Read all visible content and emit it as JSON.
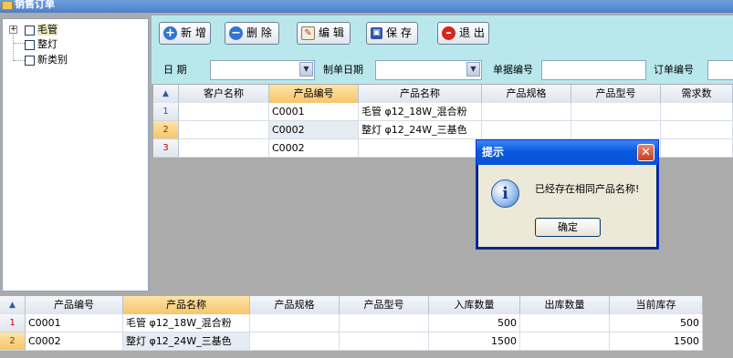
{
  "window": {
    "title": "销售订单"
  },
  "tree": {
    "nodes": [
      {
        "label": "毛管",
        "expandable": true
      },
      {
        "label": "整灯"
      },
      {
        "label": "新类别"
      }
    ]
  },
  "toolbar": {
    "add_label": "新 增",
    "delete_label": "删 除",
    "edit_label": "编 辑",
    "save_label": "保 存",
    "exit_label": "退 出"
  },
  "filters": {
    "date_label": "日  期",
    "doc_date_label": "制单日期",
    "doc_no_label": "单据编号",
    "order_no_label": "订单编号",
    "date_value": "",
    "doc_date_value": "",
    "doc_no_value": "",
    "order_no_value": ""
  },
  "order_grid": {
    "columns": [
      "客户名称",
      "产品编号",
      "产品名称",
      "产品规格",
      "产品型号",
      "需求数"
    ],
    "rows": [
      {
        "no": "1",
        "customer": "",
        "code": "C0001",
        "name": "毛管 φ12_18W_混合粉",
        "spec": "",
        "model": "",
        "qty": ""
      },
      {
        "no": "2",
        "customer": "",
        "code": "C0002",
        "name": "整灯 φ12_24W_三基色",
        "spec": "",
        "model": "",
        "qty": ""
      },
      {
        "no": "3",
        "customer": "",
        "code": "C0002",
        "name": "",
        "spec": "",
        "model": "",
        "qty": ""
      }
    ]
  },
  "stock_grid": {
    "columns": [
      "产品编号",
      "产品名称",
      "产品规格",
      "产品型号",
      "入库数量",
      "出库数量",
      "当前库存"
    ],
    "rows": [
      {
        "no": "1",
        "code": "C0001",
        "name": "毛管 φ12_18W_混合粉",
        "spec": "",
        "model": "",
        "in": "500",
        "out": "",
        "stock": "500"
      },
      {
        "no": "2",
        "code": "C0002",
        "name": "整灯 φ12_24W_三基色",
        "spec": "",
        "model": "",
        "in": "1500",
        "out": "",
        "stock": "1500"
      }
    ]
  },
  "dialog": {
    "title": "提示",
    "message": "已经存在相同产品名称!",
    "ok_label": "确定"
  },
  "colors": {
    "toolbar_bg": "#b9e8ec",
    "header_selected": "#f7c56a",
    "dialog_title": "#0a5ae0"
  }
}
